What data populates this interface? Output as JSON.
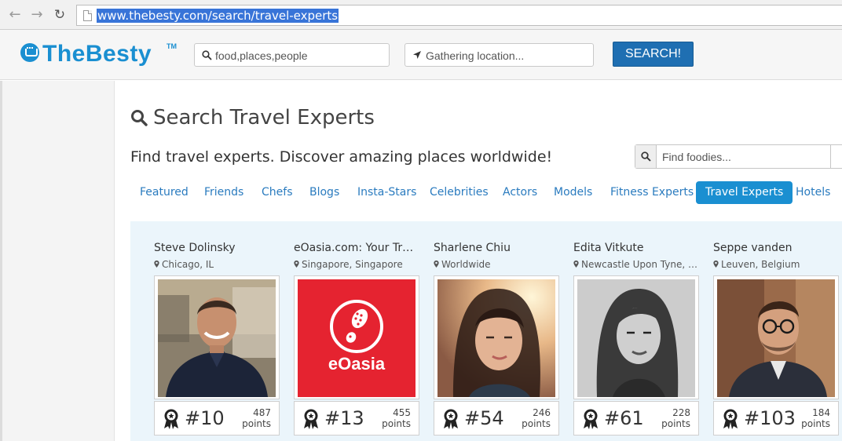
{
  "browser": {
    "url": "www.thebesty.com/search/travel-experts"
  },
  "header": {
    "logo_text": "TheBesty",
    "logo_tm": "TM",
    "search_placeholder": "food,places,people",
    "location_placeholder": "Gathering location...",
    "search_button": "SEARCH!"
  },
  "page": {
    "title": "Search Travel Experts",
    "subtitle": "Find travel experts. Discover amazing places worldwide!",
    "foodie_placeholder": "Find foodies..."
  },
  "tabs": [
    {
      "label": "Featured",
      "active": false
    },
    {
      "label": "Friends",
      "active": false
    },
    {
      "label": "Chefs",
      "active": false
    },
    {
      "label": "Blogs",
      "active": false
    },
    {
      "label": "Insta-Stars",
      "active": false
    },
    {
      "label": "Celebrities",
      "active": false
    },
    {
      "label": "Actors",
      "active": false
    },
    {
      "label": "Models",
      "active": false
    },
    {
      "label": "Fitness Experts",
      "active": false
    },
    {
      "label": "Travel Experts",
      "active": true
    },
    {
      "label": "Hotels",
      "active": false
    }
  ],
  "experts": [
    {
      "name": "Steve Dolinsky",
      "location": "Chicago, IL",
      "rank": "#10",
      "points": "487",
      "points_label": "points"
    },
    {
      "name": "eOasia.com: Your Tr…",
      "location": "Singapore, Singapore",
      "rank": "#13",
      "points": "455",
      "points_label": "points",
      "logo_text": "eOasia"
    },
    {
      "name": "Sharlene Chiu",
      "location": "Worldwide",
      "rank": "#54",
      "points": "246",
      "points_label": "points"
    },
    {
      "name": "Edita Vitkute",
      "location": "Newcastle Upon Tyne, …",
      "rank": "#61",
      "points": "228",
      "points_label": "points"
    },
    {
      "name": "Seppe vanden",
      "location": "Leuven, Belgium",
      "rank": "#103",
      "points": "184",
      "points_label": "points"
    }
  ],
  "colors": {
    "brand_blue": "#1a8fd1",
    "button_blue": "#1f6fb2",
    "panel_bg": "#ebf5fb",
    "eoasia_red": "#e52330"
  }
}
